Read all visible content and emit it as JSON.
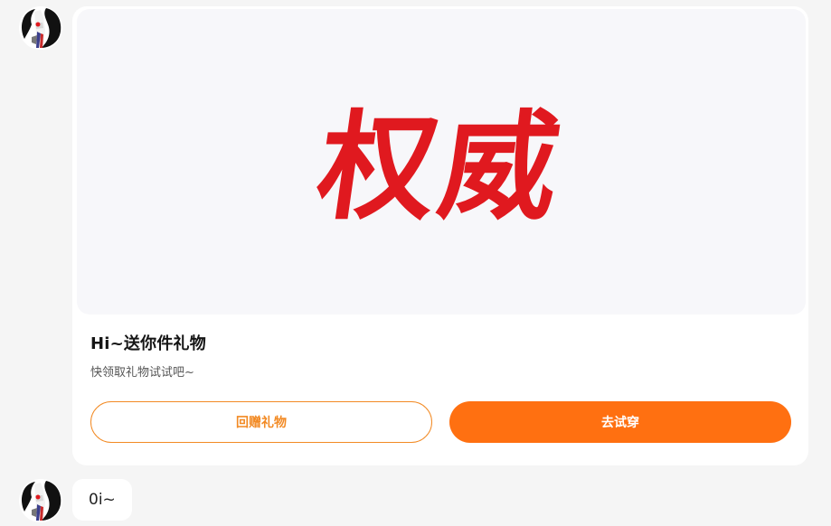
{
  "messages": [
    {
      "type": "gift_card",
      "gift_image_text": "权威",
      "title": "Hi~送你件礼物",
      "subtitle": "快领取礼物试试吧~",
      "buttons": {
        "return_gift_label": "回赠礼物",
        "try_on_label": "去试穿"
      }
    },
    {
      "type": "text",
      "text": "0i~"
    }
  ],
  "colors": {
    "accent": "#ff7011",
    "accent_outline": "#f28a24",
    "gift_text": "#e0191f"
  }
}
